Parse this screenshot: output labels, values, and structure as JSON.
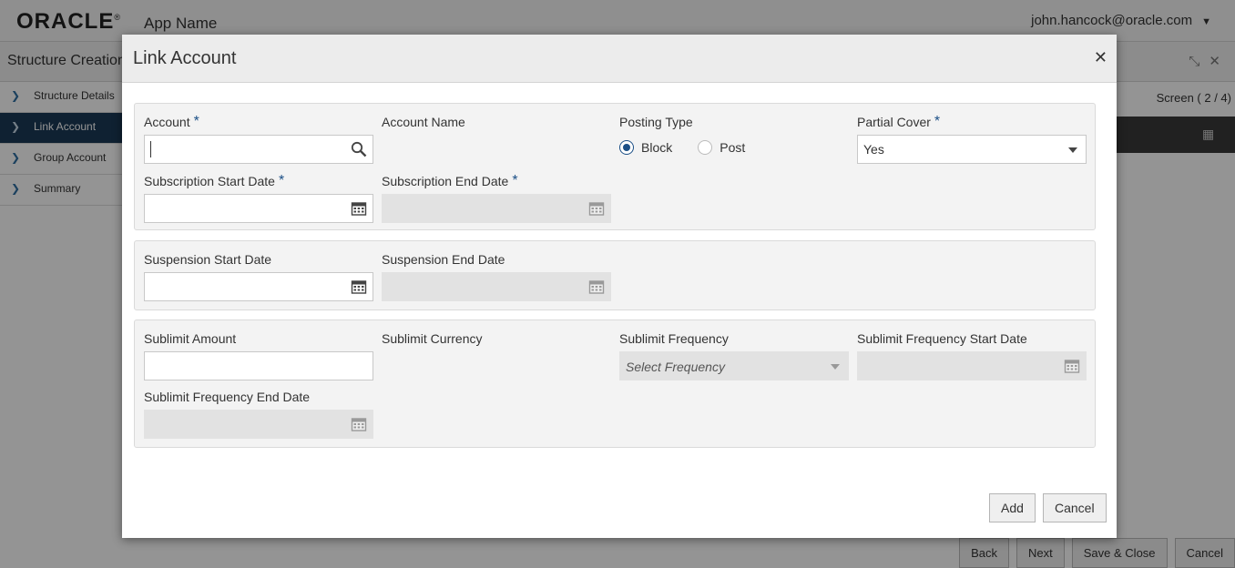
{
  "app": {
    "logo": "ORACLE",
    "name": "App Name",
    "user": "john.hancock@oracle.com"
  },
  "subheader": {
    "title": "Structure Creation",
    "screen_indicator": "Screen ( 2 / 4)"
  },
  "steps": [
    {
      "label": "Structure Details"
    },
    {
      "label": "Link Account"
    },
    {
      "label": "Group Account"
    },
    {
      "label": "Summary"
    }
  ],
  "footer": {
    "back": "Back",
    "next": "Next",
    "save_close": "Save & Close",
    "cancel": "Cancel"
  },
  "modal": {
    "title": "Link Account",
    "add": "Add",
    "cancel": "Cancel",
    "fields": {
      "account": {
        "label": "Account",
        "required_mark": "*",
        "value": ""
      },
      "account_name": {
        "label": "Account Name"
      },
      "posting_type": {
        "label": "Posting Type",
        "options": [
          "Block",
          "Post"
        ],
        "selected": "Block"
      },
      "partial_cover": {
        "label": "Partial Cover",
        "required_mark": "*",
        "value": "Yes"
      },
      "subscription_start": {
        "label": "Subscription Start Date",
        "required_mark": "*"
      },
      "subscription_end": {
        "label": "Subscription End Date",
        "required_mark": "*"
      },
      "suspension_start": {
        "label": "Suspension Start Date"
      },
      "suspension_end": {
        "label": "Suspension End Date"
      },
      "sublimit_amount": {
        "label": "Sublimit Amount"
      },
      "sublimit_currency": {
        "label": "Sublimit Currency"
      },
      "sublimit_frequency": {
        "label": "Sublimit Frequency",
        "placeholder": "Select Frequency"
      },
      "sublimit_freq_start": {
        "label": "Sublimit Frequency Start Date"
      },
      "sublimit_freq_end": {
        "label": "Sublimit Frequency End Date"
      }
    }
  },
  "colors": {
    "accent": "#1b4f86",
    "active_step": "#1b3a57",
    "overlay": "rgba(0,0,0,0.42)"
  }
}
